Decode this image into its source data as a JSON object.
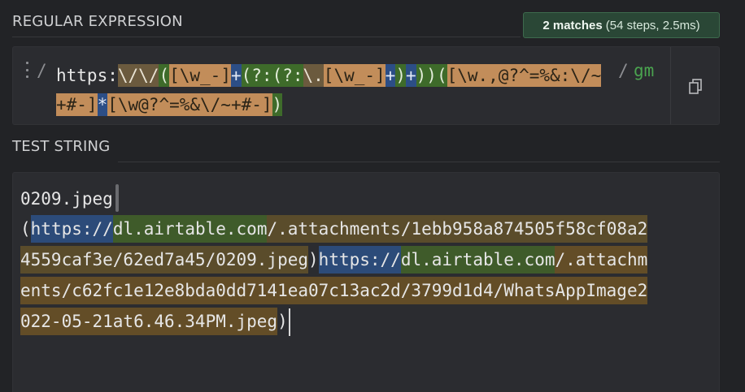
{
  "regex_section": {
    "title": "REGULAR EXPRESSION",
    "delimiter_open": "/",
    "delimiter_close": "/",
    "flags": "gm",
    "pattern_tokens": [
      {
        "t": "https:",
        "k": "lit"
      },
      {
        "t": "\\/",
        "k": "esc"
      },
      {
        "t": "\\/",
        "k": "esc"
      },
      {
        "t": "(",
        "k": "grp"
      },
      {
        "t": "[\\w_-]",
        "k": "cls"
      },
      {
        "t": "+",
        "k": "qty"
      },
      {
        "t": "(?:",
        "k": "grp"
      },
      {
        "t": "(?:",
        "k": "grp"
      },
      {
        "t": "\\.",
        "k": "esc"
      },
      {
        "t": "[\\w_-]",
        "k": "cls"
      },
      {
        "t": "+",
        "k": "qty"
      },
      {
        "t": ")",
        "k": "grp"
      },
      {
        "t": "+",
        "k": "qty"
      },
      {
        "t": ")",
        "k": "grp"
      },
      {
        "t": ")",
        "k": "grp"
      },
      {
        "t": "(",
        "k": "grp"
      },
      {
        "t": "[\\w.,@?^=%&:\\/~+#-]",
        "k": "cls"
      },
      {
        "t": "*",
        "k": "qty"
      },
      {
        "t": "[\\w@?^=%&\\/~+#-]",
        "k": "cls"
      },
      {
        "t": ")",
        "k": "grp"
      }
    ]
  },
  "match_badge": {
    "count": "2 matches",
    "detail": "(54 steps, 2.5ms)"
  },
  "icons": {
    "drag": "drag-handle-icon",
    "copy": "copy-icon"
  },
  "test_section": {
    "title": "TEST STRING",
    "lines": [
      [
        {
          "t": "0209.jpeg",
          "c": ""
        }
      ],
      [
        {
          "t": "(",
          "c": ""
        },
        {
          "t": "https://",
          "c": "mq"
        },
        {
          "t": "dl.airtable.com",
          "c": "mg1"
        },
        {
          "t": "/.attachments/1ebb958a874505f58cf08a2",
          "c": "m1"
        }
      ],
      [
        {
          "t": "4559caf3e/62ed7a45/0209.jpeg",
          "c": "m1"
        },
        {
          "t": ")",
          "c": ""
        },
        {
          "t": "https://",
          "c": "mq"
        },
        {
          "t": "dl.airtable.com",
          "c": "mg1"
        },
        {
          "t": "/.attachm",
          "c": "mg2"
        }
      ],
      [
        {
          "t": "ents/c62fc1e12e8bda0dd7141ea07c13ac2d/3799d1d4/WhatsAppImage2",
          "c": "mg2"
        }
      ],
      [
        {
          "t": "022-05-21at6.46.34PM.jpeg",
          "c": "mg2"
        },
        {
          "t": ")",
          "c": ""
        }
      ]
    ]
  }
}
